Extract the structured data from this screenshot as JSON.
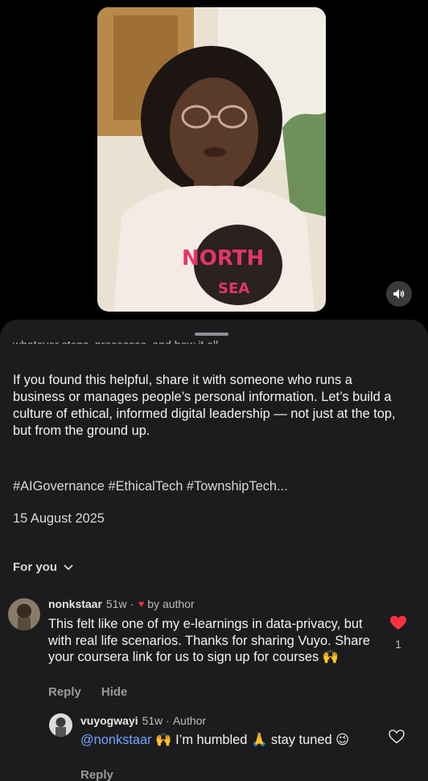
{
  "video": {
    "mute_icon": "speaker-muted-icon"
  },
  "post": {
    "cutoff_text": "whatever steps, processes, and how it all",
    "caption": "If you found this helpful, share it with someone who runs a business or manages people’s personal information. Let’s build a culture of ethical, informed digital leadership — not just at the top, but from the ground up.",
    "hashtags": "#AIGovernance #EthicalTech #TownshipTech...",
    "date": "15 August 2025"
  },
  "filter": {
    "label": "For you"
  },
  "comments": [
    {
      "username": "nonkstaar",
      "time": "51w ·",
      "liked_by_author": "by author",
      "text": "This felt like one of my e-learnings in data-privacy, but with real life scenarios. Thanks for sharing Vuyo. Share your coursera link for us to sign up for courses 🙌",
      "reply_label": "Reply",
      "hide_label": "Hide",
      "like_count": "1",
      "liked": true
    },
    {
      "username": "vuyogwayi",
      "time": "51w ·",
      "role": "Author",
      "mention": "@nonkstaar",
      "text": " 🙌 I’m humbled 🙏 stay tuned 😉",
      "reply_label": "Reply",
      "liked": false
    }
  ],
  "colors": {
    "heart": "#ff3040",
    "mention": "#6ea6ff",
    "sheet": "#1c1c1e"
  }
}
